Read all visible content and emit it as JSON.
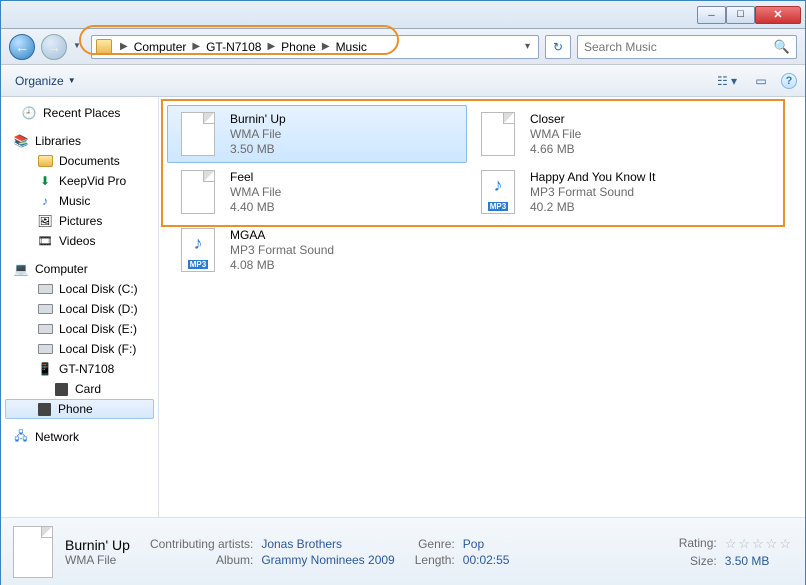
{
  "breadcrumb": {
    "seg1": "Computer",
    "seg2": "GT-N7108",
    "seg3": "Phone",
    "seg4": "Music"
  },
  "search": {
    "placeholder": "Search Music"
  },
  "toolbar": {
    "organize": "Organize"
  },
  "sidebar": {
    "recent": "Recent Places",
    "libraries": "Libraries",
    "documents": "Documents",
    "keepvid": "KeepVid Pro",
    "music": "Music",
    "pictures": "Pictures",
    "videos": "Videos",
    "computer": "Computer",
    "c": "Local Disk (C:)",
    "d": "Local Disk (D:)",
    "e": "Local Disk (E:)",
    "f": "Local Disk (F:)",
    "device": "GT-N7108",
    "card": "Card",
    "phone": "Phone",
    "network": "Network"
  },
  "files": [
    {
      "name": "Burnin' Up",
      "type": "WMA File",
      "size": "3.50 MB",
      "icon": "doc",
      "selected": true
    },
    {
      "name": "Closer",
      "type": "WMA File",
      "size": "4.66 MB",
      "icon": "doc",
      "selected": false
    },
    {
      "name": "Feel",
      "type": "WMA File",
      "size": "4.40 MB",
      "icon": "doc",
      "selected": false
    },
    {
      "name": "Happy And You Know It",
      "type": "MP3 Format Sound",
      "size": "40.2 MB",
      "icon": "mp3",
      "selected": false
    },
    {
      "name": "MGAA",
      "type": "MP3 Format Sound",
      "size": "4.08 MB",
      "icon": "mp3",
      "selected": false
    }
  ],
  "details": {
    "name": "Burnin' Up",
    "type": "WMA File",
    "artists_lbl": "Contributing artists:",
    "artists": "Jonas Brothers",
    "album_lbl": "Album:",
    "album": "Grammy Nominees 2009",
    "genre_lbl": "Genre:",
    "genre": "Pop",
    "length_lbl": "Length:",
    "length": "00:02:55",
    "rating_lbl": "Rating:",
    "size_lbl": "Size:",
    "size": "3.50 MB"
  },
  "mp3tag": "MP3"
}
